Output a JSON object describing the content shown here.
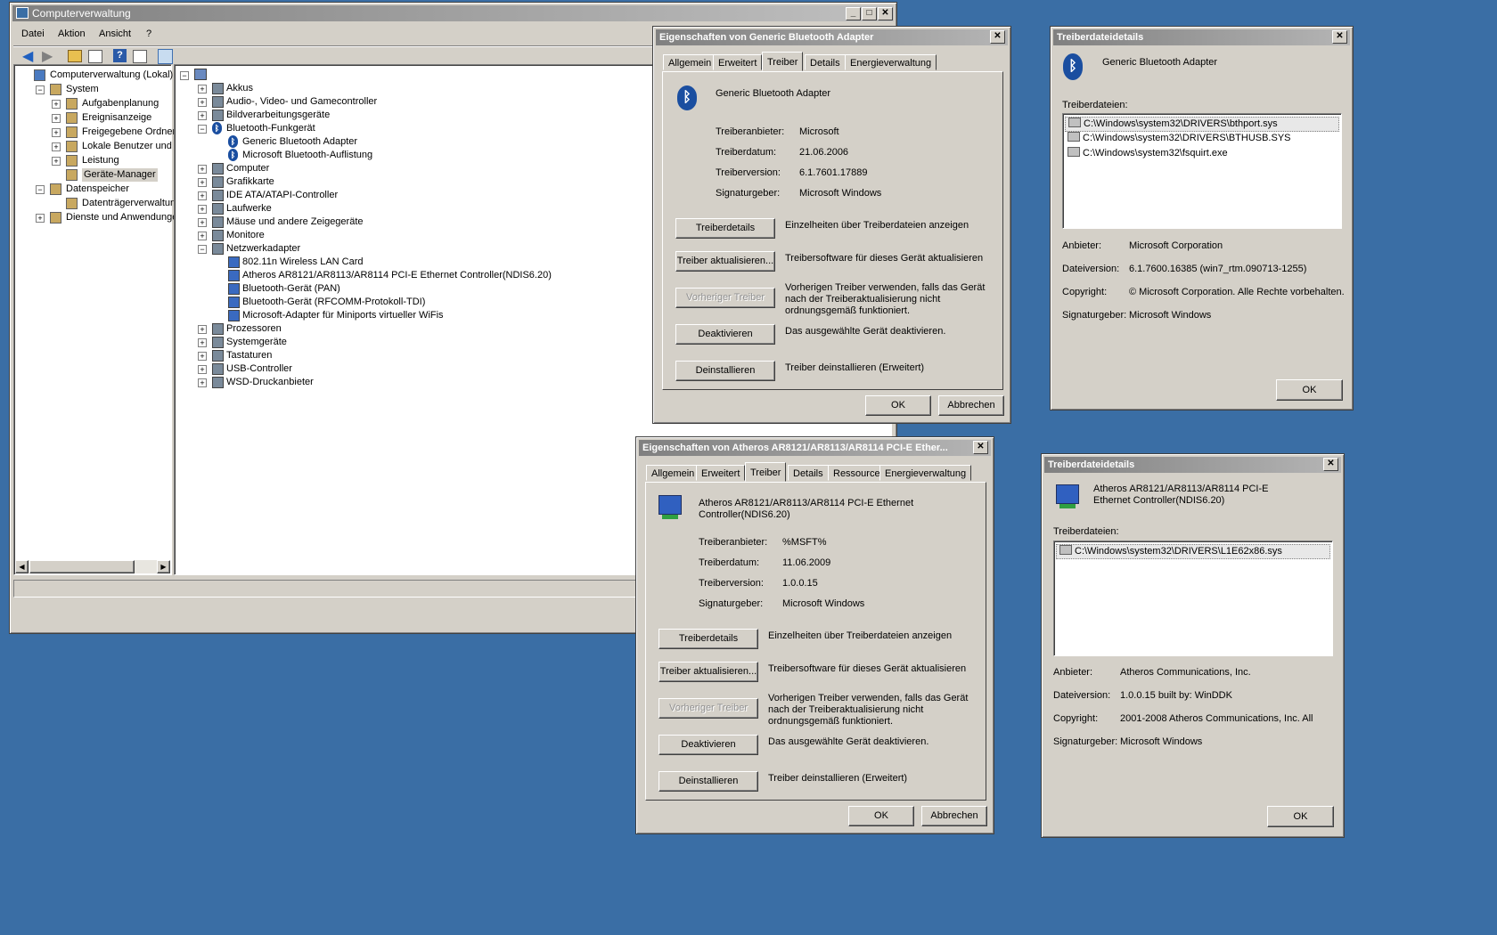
{
  "main": {
    "title": "Computerverwaltung",
    "menu": [
      "Datei",
      "Aktion",
      "Ansicht",
      "?"
    ],
    "left_tree": [
      {
        "label": "Computerverwaltung (Lokal)",
        "level": 0,
        "exp": ""
      },
      {
        "label": "System",
        "level": 1,
        "exp": "−"
      },
      {
        "label": "Aufgabenplanung",
        "level": 2,
        "exp": "+"
      },
      {
        "label": "Ereignisanzeige",
        "level": 2,
        "exp": "+"
      },
      {
        "label": "Freigegebene Ordner",
        "level": 2,
        "exp": "+"
      },
      {
        "label": "Lokale Benutzer und Grupp",
        "level": 2,
        "exp": "+"
      },
      {
        "label": "Leistung",
        "level": 2,
        "exp": "+"
      },
      {
        "label": "Geräte-Manager",
        "level": 2,
        "exp": "",
        "selected": true
      },
      {
        "label": "Datenspeicher",
        "level": 1,
        "exp": "−"
      },
      {
        "label": "Datenträgerverwaltung",
        "level": 2,
        "exp": ""
      },
      {
        "label": "Dienste und Anwendungen",
        "level": 1,
        "exp": "+"
      }
    ],
    "device_tree": [
      {
        "label": "Akkus",
        "level": 1,
        "exp": "+"
      },
      {
        "label": "Audio-, Video- und Gamecontroller",
        "level": 1,
        "exp": "+"
      },
      {
        "label": "Bildverarbeitungsgeräte",
        "level": 1,
        "exp": "+"
      },
      {
        "label": "Bluetooth-Funkgerät",
        "level": 1,
        "exp": "−",
        "icon": "bt"
      },
      {
        "label": "Generic Bluetooth Adapter",
        "level": 2,
        "exp": "",
        "icon": "bt"
      },
      {
        "label": "Microsoft Bluetooth-Auflistung",
        "level": 2,
        "exp": "",
        "icon": "bt"
      },
      {
        "label": "Computer",
        "level": 1,
        "exp": "+"
      },
      {
        "label": "Grafikkarte",
        "level": 1,
        "exp": "+"
      },
      {
        "label": "IDE ATA/ATAPI-Controller",
        "level": 1,
        "exp": "+"
      },
      {
        "label": "Laufwerke",
        "level": 1,
        "exp": "+"
      },
      {
        "label": "Mäuse und andere Zeigegeräte",
        "level": 1,
        "exp": "+"
      },
      {
        "label": "Monitore",
        "level": 1,
        "exp": "+"
      },
      {
        "label": "Netzwerkadapter",
        "level": 1,
        "exp": "−"
      },
      {
        "label": "802.11n Wireless LAN Card",
        "level": 2,
        "exp": ""
      },
      {
        "label": "Atheros AR8121/AR8113/AR8114 PCI-E Ethernet Controller(NDIS6.20)",
        "level": 2,
        "exp": ""
      },
      {
        "label": "Bluetooth-Gerät (PAN)",
        "level": 2,
        "exp": ""
      },
      {
        "label": "Bluetooth-Gerät (RFCOMM-Protokoll-TDI)",
        "level": 2,
        "exp": ""
      },
      {
        "label": "Microsoft-Adapter für Miniports virtueller WiFis",
        "level": 2,
        "exp": ""
      },
      {
        "label": "Prozessoren",
        "level": 1,
        "exp": "+"
      },
      {
        "label": "Systemgeräte",
        "level": 1,
        "exp": "+"
      },
      {
        "label": "Tastaturen",
        "level": 1,
        "exp": "+"
      },
      {
        "label": "USB-Controller",
        "level": 1,
        "exp": "+"
      },
      {
        "label": "WSD-Druckanbieter",
        "level": 1,
        "exp": "+"
      }
    ]
  },
  "bt_props": {
    "title": "Eigenschaften von Generic Bluetooth Adapter",
    "tabs": [
      "Allgemein",
      "Erweitert",
      "Treiber",
      "Details",
      "Energieverwaltung"
    ],
    "active_tab": 2,
    "device_name": "Generic Bluetooth Adapter",
    "fields": [
      {
        "label": "Treiberanbieter:",
        "value": "Microsoft"
      },
      {
        "label": "Treiberdatum:",
        "value": "21.06.2006"
      },
      {
        "label": "Treiberversion:",
        "value": "6.1.7601.17889"
      },
      {
        "label": "Signaturgeber:",
        "value": "Microsoft Windows"
      }
    ],
    "actions": [
      {
        "button": "Treiberdetails",
        "text": "Einzelheiten über Treiberdateien anzeigen",
        "disabled": false
      },
      {
        "button": "Treiber aktualisieren...",
        "text": "Treibersoftware für dieses Gerät aktualisieren",
        "disabled": false
      },
      {
        "button": "Vorheriger Treiber",
        "text": "Vorherigen Treiber verwenden, falls das Gerät nach der Treiberaktualisierung nicht ordnungsgemäß funktioniert.",
        "disabled": true
      },
      {
        "button": "Deaktivieren",
        "text": "Das ausgewählte Gerät deaktivieren.",
        "disabled": false
      },
      {
        "button": "Deinstallieren",
        "text": "Treiber deinstallieren (Erweitert)",
        "disabled": false
      }
    ],
    "ok": "OK",
    "cancel": "Abbrechen"
  },
  "bt_details": {
    "title": "Treiberdateidetails",
    "device_name": "Generic Bluetooth Adapter",
    "files_label": "Treiberdateien:",
    "files": [
      "C:\\Windows\\system32\\DRIVERS\\bthport.sys",
      "C:\\Windows\\system32\\DRIVERS\\BTHUSB.SYS",
      "C:\\Windows\\system32\\fsquirt.exe"
    ],
    "fields": [
      {
        "label": "Anbieter:",
        "value": "Microsoft Corporation"
      },
      {
        "label": "Dateiversion:",
        "value": "6.1.7600.16385 (win7_rtm.090713-1255)"
      },
      {
        "label": "Copyright:",
        "value": "© Microsoft Corporation. Alle Rechte vorbehalten."
      },
      {
        "label": "Signaturgeber:",
        "value": "Microsoft Windows"
      }
    ],
    "ok": "OK"
  },
  "eth_props": {
    "title": "Eigenschaften von Atheros AR8121/AR8113/AR8114 PCI-E Ether...",
    "tabs": [
      "Allgemein",
      "Erweitert",
      "Treiber",
      "Details",
      "Ressourcen",
      "Energieverwaltung"
    ],
    "active_tab": 2,
    "device_name": "Atheros AR8121/AR8113/AR8114 PCI-E Ethernet Controller(NDIS6.20)",
    "fields": [
      {
        "label": "Treiberanbieter:",
        "value": "%MSFT%"
      },
      {
        "label": "Treiberdatum:",
        "value": "11.06.2009"
      },
      {
        "label": "Treiberversion:",
        "value": "1.0.0.15"
      },
      {
        "label": "Signaturgeber:",
        "value": "Microsoft Windows"
      }
    ],
    "actions": [
      {
        "button": "Treiberdetails",
        "text": "Einzelheiten über Treiberdateien anzeigen",
        "disabled": false
      },
      {
        "button": "Treiber aktualisieren...",
        "text": "Treibersoftware für dieses Gerät aktualisieren",
        "disabled": false
      },
      {
        "button": "Vorheriger Treiber",
        "text": "Vorherigen Treiber verwenden, falls das Gerät nach der Treiberaktualisierung nicht ordnungsgemäß funktioniert.",
        "disabled": true
      },
      {
        "button": "Deaktivieren",
        "text": "Das ausgewählte Gerät deaktivieren.",
        "disabled": false
      },
      {
        "button": "Deinstallieren",
        "text": "Treiber deinstallieren (Erweitert)",
        "disabled": false
      }
    ],
    "ok": "OK",
    "cancel": "Abbrechen"
  },
  "eth_details": {
    "title": "Treiberdateidetails",
    "device_name": "Atheros AR8121/AR8113/AR8114 PCI-E Ethernet Controller(NDIS6.20)",
    "files_label": "Treiberdateien:",
    "files": [
      "C:\\Windows\\system32\\DRIVERS\\L1E62x86.sys"
    ],
    "fields": [
      {
        "label": "Anbieter:",
        "value": "Atheros Communications, Inc."
      },
      {
        "label": "Dateiversion:",
        "value": "1.0.0.15 built by: WinDDK"
      },
      {
        "label": "Copyright:",
        "value": "2001-2008 Atheros Communications, Inc. All"
      },
      {
        "label": "Signaturgeber:",
        "value": "Microsoft Windows"
      }
    ],
    "ok": "OK"
  }
}
